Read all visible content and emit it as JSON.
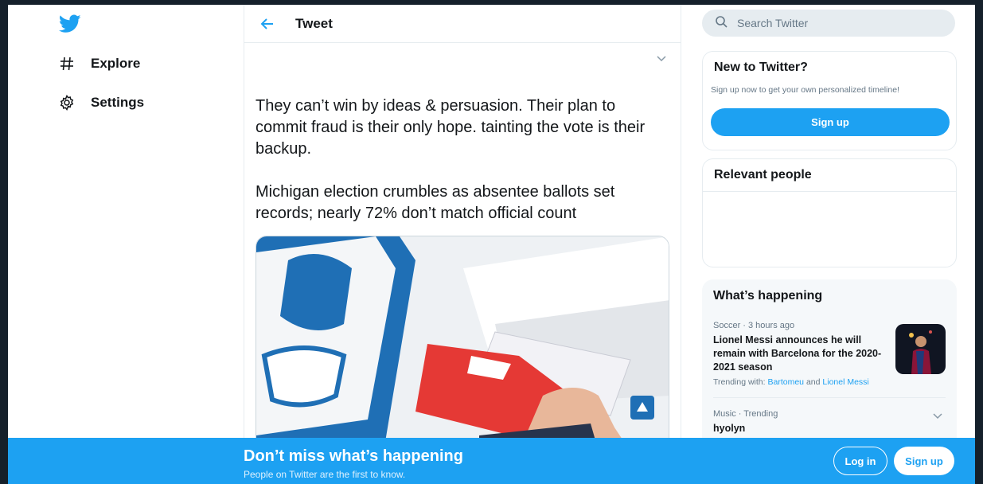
{
  "nav": {
    "items": [
      {
        "label": "Explore",
        "icon": "hashtag-icon"
      },
      {
        "label": "Settings",
        "icon": "gear-icon"
      }
    ]
  },
  "main": {
    "title": "Tweet",
    "tweet": {
      "paragraph1": "They can’t win by ideas & persuasion. Their plan to commit fraud is their only hope. tainting the vote is their backup.",
      "paragraph2": "Michigan election crumbles as absentee ballots set records; nearly 72% don’t match official count"
    }
  },
  "right": {
    "search_placeholder": "Search Twitter",
    "new_to_twitter": {
      "title": "New to Twitter?",
      "subtitle": "Sign up now to get your own personalized timeline!",
      "signup_label": "Sign up"
    },
    "relevant_people": {
      "title": "Relevant people"
    },
    "happening": {
      "title": "What’s happening",
      "trends": [
        {
          "meta": "Soccer · 3 hours ago",
          "headline": "Lionel Messi announces he will remain with Barcelona for the 2020-2021 season",
          "trending_prefix": "Trending with:",
          "trending_link1": "Bartomeu",
          "trending_and": "and",
          "trending_link2": "Lionel Messi"
        },
        {
          "meta": "Music · Trending",
          "headline": "hyolyn"
        }
      ]
    }
  },
  "bottom_bar": {
    "title": "Don’t miss what’s happening",
    "subtitle": "People on Twitter are the first to know.",
    "login_label": "Log in",
    "signup_label": "Sign up"
  },
  "colors": {
    "accent": "#1da1f2",
    "text": "#14171a",
    "muted": "#657786",
    "border": "#e6ecf0",
    "desktop_bg": "#15202b"
  }
}
